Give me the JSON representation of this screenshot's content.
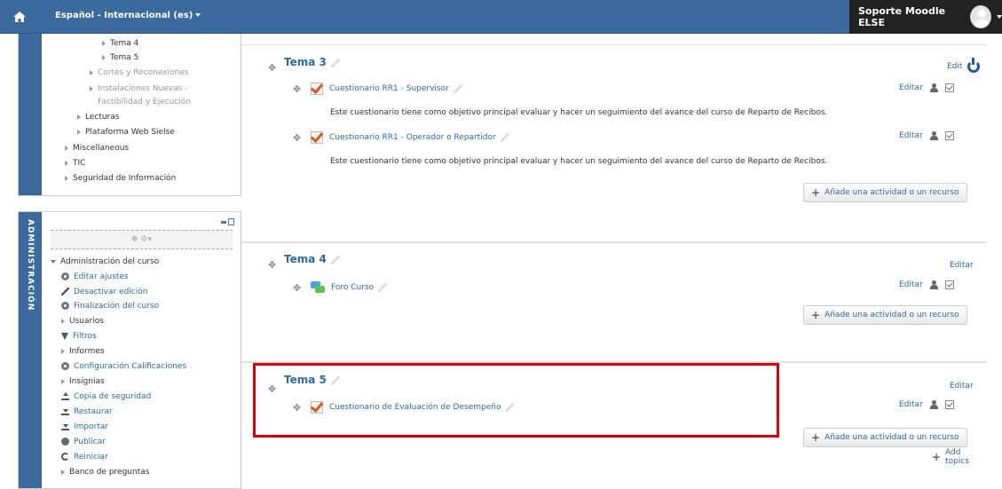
{
  "navbar": {
    "language": "Español - Internacional (es)",
    "user_name": "Soporte Moodle ELSE"
  },
  "nav_tree": {
    "items": [
      {
        "label": "Tema 4"
      },
      {
        "label": "Tema 5"
      },
      {
        "label": "Cortes y Reconexiones"
      },
      {
        "label": "Instalaciones Nuevas -"
      },
      {
        "label": "Factibilidad y Ejecución"
      },
      {
        "label": "Lecturas"
      },
      {
        "label": "Plataforma Web Sielse"
      },
      {
        "label": "Miscellaneous"
      },
      {
        "label": "TIC"
      },
      {
        "label": "Seguridad de Información"
      }
    ]
  },
  "admin_block": {
    "title": "ADMINISTRACIÓN",
    "header": "Administración del curso",
    "items": [
      {
        "label": "Editar ajustes",
        "icon": "gear-icon"
      },
      {
        "label": "Desactivar edición",
        "icon": "pencil-icon"
      },
      {
        "label": "Finalización del curso",
        "icon": "gear-icon"
      },
      {
        "label": "Usuarios",
        "icon": "triangle-icon"
      },
      {
        "label": "Filtros",
        "icon": "filter-icon"
      },
      {
        "label": "Informes",
        "icon": "triangle-icon"
      },
      {
        "label": "Configuración Calificaciones",
        "icon": "gear-icon"
      },
      {
        "label": "Insignias",
        "icon": "triangle-icon"
      },
      {
        "label": "Copia de seguridad",
        "icon": "upload-icon"
      },
      {
        "label": "Restaurar",
        "icon": "download-icon"
      },
      {
        "label": "Importar",
        "icon": "download-icon"
      },
      {
        "label": "Publicar",
        "icon": "globe-icon"
      },
      {
        "label": "Reiniciar",
        "icon": "refresh-icon"
      },
      {
        "label": "Banco de preguntas",
        "icon": "triangle-icon"
      }
    ]
  },
  "sections": {
    "tema3": {
      "title": "Tema 3",
      "edit": "Edit",
      "activities": [
        {
          "name": "Cuestionario RR1 - Supervisor",
          "desc": "Este cuestionario tiene como objetivo principal evaluar y hacer un seguimiento del avance del curso de Reparto de Recibos.",
          "edit": "Editar"
        },
        {
          "name": "Cuestionario RR1 - Operador o Repartidor",
          "desc": "Este cuestionario tiene como objetivo principal evaluar y hacer un seguimiento del avance del curso de Reparto de Recibos.",
          "edit": "Editar"
        }
      ],
      "add": "Añade una actividad o un recurso"
    },
    "tema4": {
      "title": "Tema 4",
      "edit": "Editar",
      "activities": [
        {
          "name": "Foro Curso",
          "edit": "Editar"
        }
      ],
      "add": "Añade una actividad o un recurso"
    },
    "tema5": {
      "title": "Tema 5",
      "edit": "Editar",
      "activities": [
        {
          "name": "Cuestionario de Evaluación de Desempeño",
          "edit": "Editar"
        }
      ],
      "add": "Añade una actividad o un recurso"
    }
  },
  "add_topics": "Add topics",
  "colors": {
    "navbar": "#3a6a9e",
    "link": "#2a6aa8",
    "highlight": "#e30000"
  }
}
